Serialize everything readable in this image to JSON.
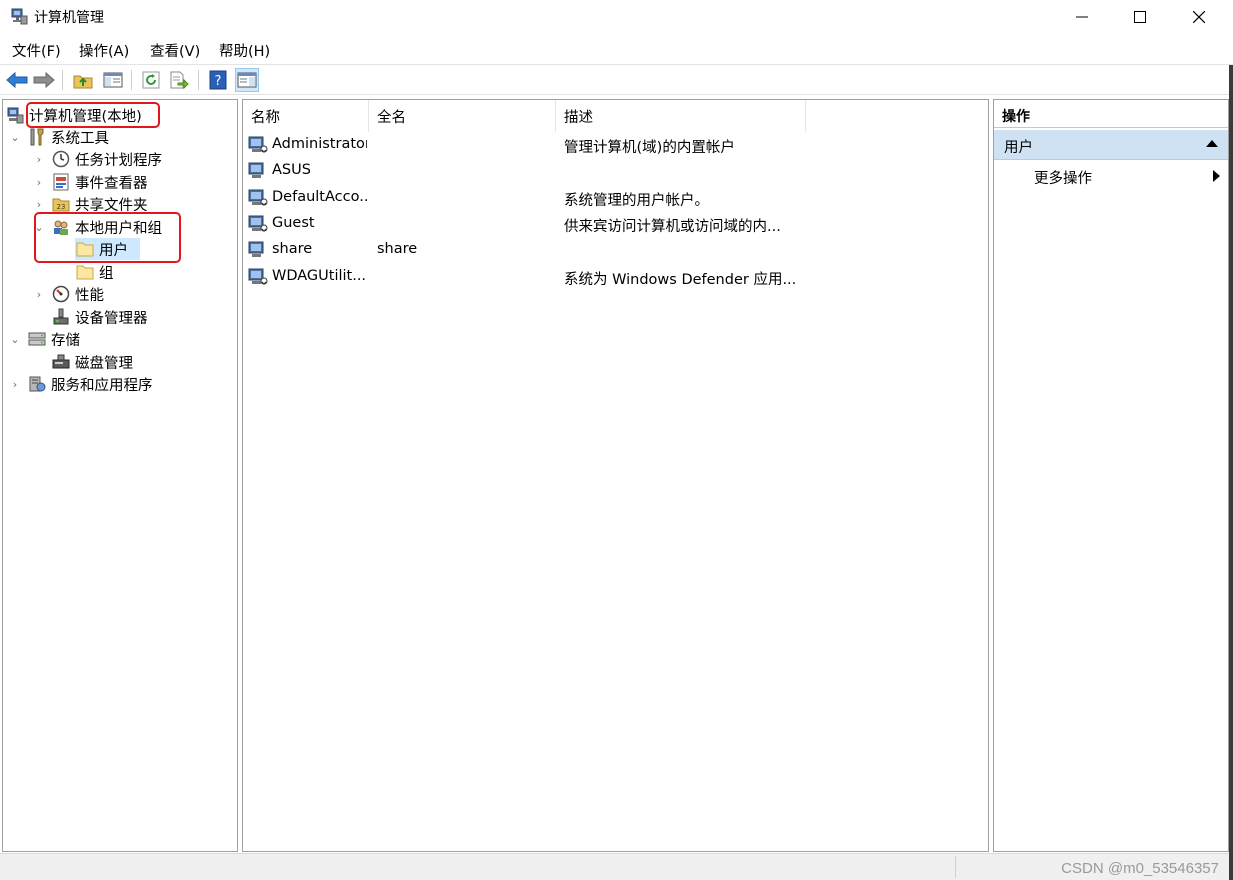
{
  "window": {
    "title": "计算机管理",
    "controls": {
      "minimize": "minimize-icon",
      "maximize": "maximize-icon",
      "close": "close-icon"
    }
  },
  "menu": [
    "文件(F)",
    "操作(A)",
    "查看(V)",
    "帮助(H)"
  ],
  "toolbar": [
    "back-arrow-icon",
    "forward-arrow-icon",
    "up-folder-icon",
    "show-hide-tree-icon",
    "refresh-icon",
    "export-list-icon",
    "help-icon",
    "show-hide-action-pane-icon"
  ],
  "tree": {
    "root": "计算机管理(本地)",
    "system_tools": "系统工具",
    "task_scheduler": "任务计划程序",
    "event_viewer": "事件查看器",
    "shared_folders": "共享文件夹",
    "local_users_groups": "本地用户和组",
    "users": "用户",
    "groups": "组",
    "performance": "性能",
    "device_manager": "设备管理器",
    "storage": "存储",
    "disk_management": "磁盘管理",
    "services_apps": "服务和应用程序"
  },
  "list": {
    "columns": [
      "名称",
      "全名",
      "描述"
    ],
    "rows": [
      {
        "name": "Administrator",
        "fullname": "",
        "desc": "管理计算机(域)的内置帐户"
      },
      {
        "name": "ASUS",
        "fullname": "",
        "desc": ""
      },
      {
        "name": "DefaultAcco...",
        "fullname": "",
        "desc": "系统管理的用户帐户。"
      },
      {
        "name": "Guest",
        "fullname": "",
        "desc": "供来宾访问计算机或访问域的内..."
      },
      {
        "name": "share",
        "fullname": "share",
        "desc": ""
      },
      {
        "name": "WDAGUtilit...",
        "fullname": "",
        "desc": "系统为 Windows Defender 应用..."
      }
    ]
  },
  "actions": {
    "title": "操作",
    "section": "用户",
    "more": "更多操作"
  },
  "watermark": "CSDN @m0_53546357",
  "colors": {
    "selection": "#cde8ff",
    "highlight_box": "#e3161b",
    "action_section": "#cfe2f3"
  }
}
